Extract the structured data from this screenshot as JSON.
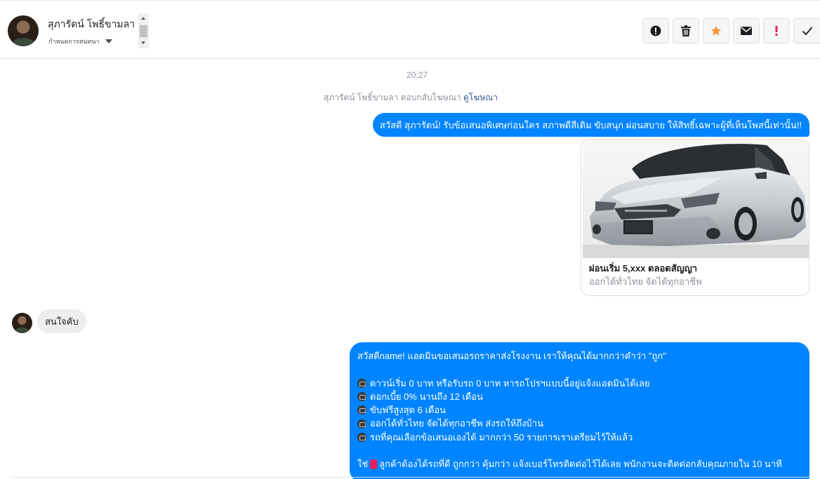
{
  "header": {
    "contact_name": "สุภารัตน์ โพธิ์ขามลา",
    "assign_label": "กำหนดการสนทนา",
    "toolbar": [
      {
        "name": "info-circle-icon"
      },
      {
        "name": "trash-icon"
      },
      {
        "name": "star-icon",
        "color": "#f7923b"
      },
      {
        "name": "envelope-icon"
      },
      {
        "name": "exclamation-icon",
        "color": "#e0245e"
      },
      {
        "name": "checkmark-icon"
      }
    ]
  },
  "conversation": {
    "timestamp": "20:27",
    "system_line": {
      "text": "สุภารัตน์ โพธิ์ขามลา ตอบกลับโฆษณา",
      "link": "ดูโฆษณา"
    },
    "message_1": "สวัสดี สุภารัตน์! รับข้อเสนอพิเศษก่อนใคร สภาพดีสีเดิม ขับสนุก ผ่อนสบาย ให้สิทธิ์เฉพาะผู้ที่เห็นโพสนี้เท่านั้น!!",
    "ad_card": {
      "title": "ผ่อนเริ่ม 5,xxx ตลอดสัญญา",
      "subtitle": "ออกได้ทั่วไทย จัดได้ทุกอาชีพ"
    },
    "incoming_reply": "สนใจคับ",
    "message_2": {
      "intro": "สวัสดีname! แอดมินขอเสนอรถราคาส่งโรงงาน เราให้คุณได้มากกว่าคำว่า \"ถูก\"",
      "bullets": [
        "ดาวน์เริ่ม 0 บาท หรือรับรถ 0 บาท หารถโปรฯแบบนี้อยู่แจ้งแอดมินได้เลย",
        "ดอกเบี้ย 0% นานถึง 12 เดือน",
        "ขับฟรีสูงสุด 6 เดือน",
        "ออกได้ทั่วไทย จัดได้ทุกอาชีพ ส่งรถให้ถึงบ้าน",
        "รถที่คุณเลือกข้อเสนอเองได้ มากกว่า 50 รายการเราเตรียมไว้ให้แล้ว"
      ],
      "closing_prefix": "ใช่",
      "closing_text": "ลูกค้าต้องได้รถที่ดี ถูกกว่า คุ้มกว่า แจ้งเบอร์โทรติดต่อไว้ได้เลย พนักงานจะติดต่อกลับคุณภายใน 10 นาที"
    },
    "colors": {
      "outgoing_bubble": "#0084ff",
      "incoming_bubble": "#eeeeee"
    }
  }
}
